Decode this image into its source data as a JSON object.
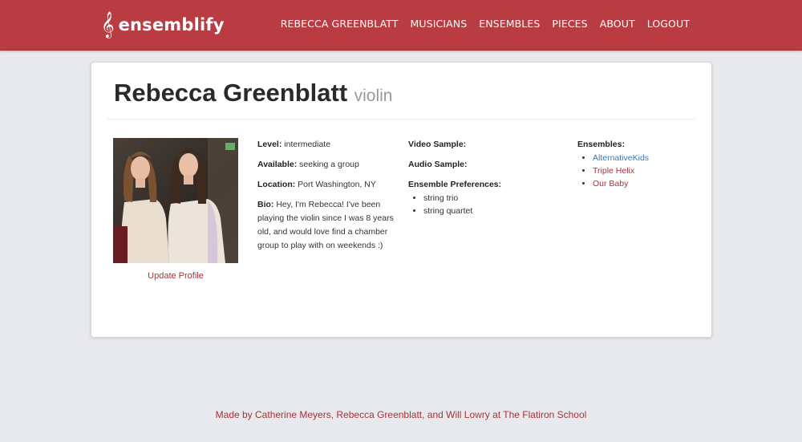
{
  "nav": {
    "brand": "ensemblify",
    "brand_icon": "treble-clef-icon",
    "links": [
      "REBECCA GREENBLATT",
      "MUSICIANS",
      "ENSEMBLES",
      "PIECES",
      "ABOUT",
      "LOGOUT"
    ]
  },
  "profile": {
    "name": "Rebecca Greenblatt",
    "instrument": "violin",
    "update_link": "Update Profile",
    "level_label": "Level:",
    "level": "intermediate",
    "available_label": "Available:",
    "available": "seeking a group",
    "location_label": "Location:",
    "location": "Port Washington, NY",
    "bio_label": "Bio:",
    "bio": "Hey, I'm Rebecca! I've been playing the violin since I was 8 years old, and would love find a chamber group to play with on weekends :)",
    "video_label": "Video Sample:",
    "audio_label": "Audio Sample:",
    "preferences_label": "Ensemble Preferences:",
    "preferences": [
      "string trio",
      "string quartet"
    ],
    "ensembles_label": "Ensembles:",
    "ensembles": [
      "AlternativeKids",
      "Triple Helix",
      "Our Baby"
    ]
  },
  "footer": {
    "text": "Made by Catherine Meyers, Rebecca Greenblatt, and Will Lowry at The Flatiron School"
  },
  "colors": {
    "navbar": "#b93c43",
    "link_red": "#a8323a",
    "link_blue": "#337ab7",
    "background": "#e8e9ec"
  }
}
